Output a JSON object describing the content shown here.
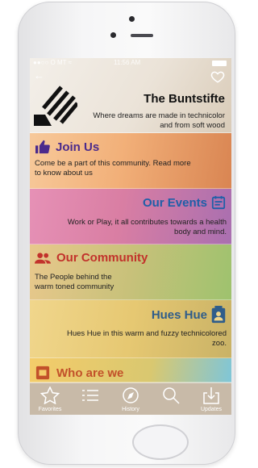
{
  "status_bar": {
    "carrier": "●●○○ O MT ≈",
    "time": "11:56 AM"
  },
  "brand": {
    "title": "The Buntstifte",
    "subtitle": "Where dreams are made in technicolor and from soft wood"
  },
  "sections": [
    {
      "title": "Join Us",
      "description": "Come be a part of this community. Read more to know about us",
      "icon": "thumbs-up-icon",
      "color": "#4b2a8c"
    },
    {
      "title": "Our Events",
      "description": "Work or Play, it all contributes towards a health body and mind.",
      "icon": "calendar-icon",
      "color": "#1f5fa8"
    },
    {
      "title": "Our Community",
      "description": "The People behind the warm toned community",
      "icon": "people-icon",
      "color": "#c2322b"
    },
    {
      "title": "Hues Hue",
      "description": "Hues Hue in this warm and fuzzy technicolored zoo.",
      "icon": "contact-icon",
      "color": "#2f5d8a"
    },
    {
      "title": "Who are we",
      "description": "",
      "icon": "info-icon",
      "color": "#c2512a"
    }
  ],
  "tabs": [
    {
      "label": "Favorites",
      "icon": "star-icon"
    },
    {
      "label": "",
      "icon": "list-icon"
    },
    {
      "label": "History",
      "icon": "compass-icon"
    },
    {
      "label": "",
      "icon": "search-icon"
    },
    {
      "label": "Updates",
      "icon": "download-icon"
    }
  ]
}
